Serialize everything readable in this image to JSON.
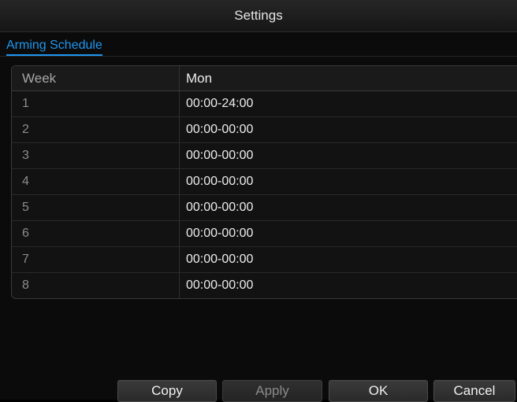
{
  "window": {
    "title": "Settings"
  },
  "tabs": {
    "active_label": "Arming Schedule"
  },
  "table": {
    "header": {
      "index_label": "Week",
      "day_label": "Mon"
    },
    "rows": [
      {
        "index": "1",
        "value": "00:00-24:00"
      },
      {
        "index": "2",
        "value": "00:00-00:00"
      },
      {
        "index": "3",
        "value": "00:00-00:00"
      },
      {
        "index": "4",
        "value": "00:00-00:00"
      },
      {
        "index": "5",
        "value": "00:00-00:00"
      },
      {
        "index": "6",
        "value": "00:00-00:00"
      },
      {
        "index": "7",
        "value": "00:00-00:00"
      },
      {
        "index": "8",
        "value": "00:00-00:00"
      }
    ]
  },
  "buttons": {
    "copy_label": "Copy",
    "apply_label": "Apply",
    "ok_label": "OK",
    "cancel_label": "Cancel"
  },
  "colors": {
    "accent": "#1e96ee",
    "background": "#0b0b0b"
  }
}
